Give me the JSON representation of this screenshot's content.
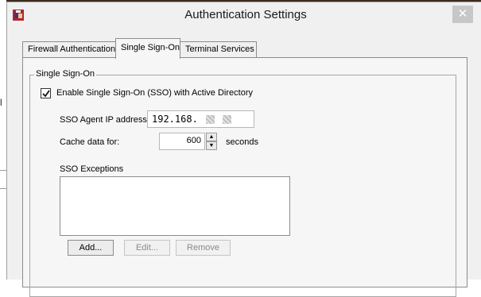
{
  "window": {
    "title": "Authentication Settings",
    "close_glyph": "✕"
  },
  "tabs": [
    {
      "label": "Firewall Authentication",
      "active": false
    },
    {
      "label": "Single Sign-On",
      "active": true
    },
    {
      "label": "Terminal Services",
      "active": false
    }
  ],
  "sso": {
    "group_label": "Single Sign-On",
    "enable_label": "Enable Single Sign-On (SSO) with Active Directory",
    "enable_checked": true,
    "agent_ip_label": "SSO Agent IP address:",
    "agent_ip_value": "192.168.",
    "cache_label": "Cache data for:",
    "cache_value": "600",
    "cache_unit": "seconds",
    "exceptions_label": "SSO Exceptions",
    "buttons": {
      "add": "Add...",
      "edit": "Edit...",
      "remove": "Remove"
    }
  },
  "icons": {
    "app": "firebox-app-icon",
    "close": "close-icon",
    "check": "checkmark-icon",
    "spin_up": "spin-up-icon",
    "spin_down": "spin-down-icon"
  },
  "colors": {
    "window_bg": "#f0f0f0",
    "panel_bg": "#f6f6f6",
    "close_bg": "#c7c7c7",
    "app_icon_red": "#b3262d"
  }
}
